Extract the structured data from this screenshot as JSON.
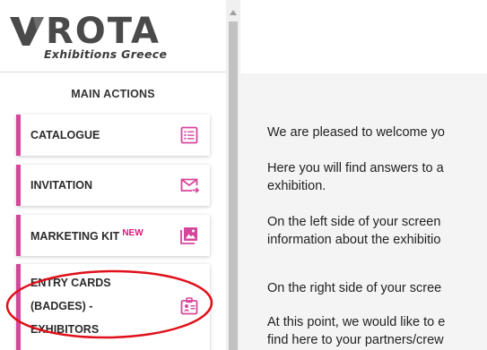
{
  "brand": {
    "logo_main": "ROTA",
    "logo_sub": "Exhibitions Greece"
  },
  "sidebar": {
    "section_title": "MAIN ACTIONS",
    "items": [
      {
        "label": "CATALOGUE",
        "icon": "catalogue-list-icon"
      },
      {
        "label": "INVITATION",
        "icon": "envelope-send-icon"
      },
      {
        "label": "MARKETING KIT",
        "badge": "NEW",
        "icon": "image-gallery-icon"
      },
      {
        "label_lines": [
          "ENTRY CARDS",
          "(BADGES) -",
          "EXHIBITORS"
        ],
        "icon": "id-badge-icon"
      }
    ]
  },
  "main": {
    "paragraphs": [
      [
        "We are pleased to welcome yo"
      ],
      [
        "Here you will find answers to a",
        "exhibition."
      ],
      [
        "On the left side of your screen",
        "information about the exhibitio"
      ],
      [
        "On the right side of your scree"
      ],
      [
        "At this point, we would like to e",
        "find here to your partners/crew"
      ]
    ]
  },
  "colors": {
    "accent": "#d6479b",
    "new_badge": "#e0157a",
    "annotation": "#e0101a",
    "content_bg": "#f4f4f4"
  }
}
